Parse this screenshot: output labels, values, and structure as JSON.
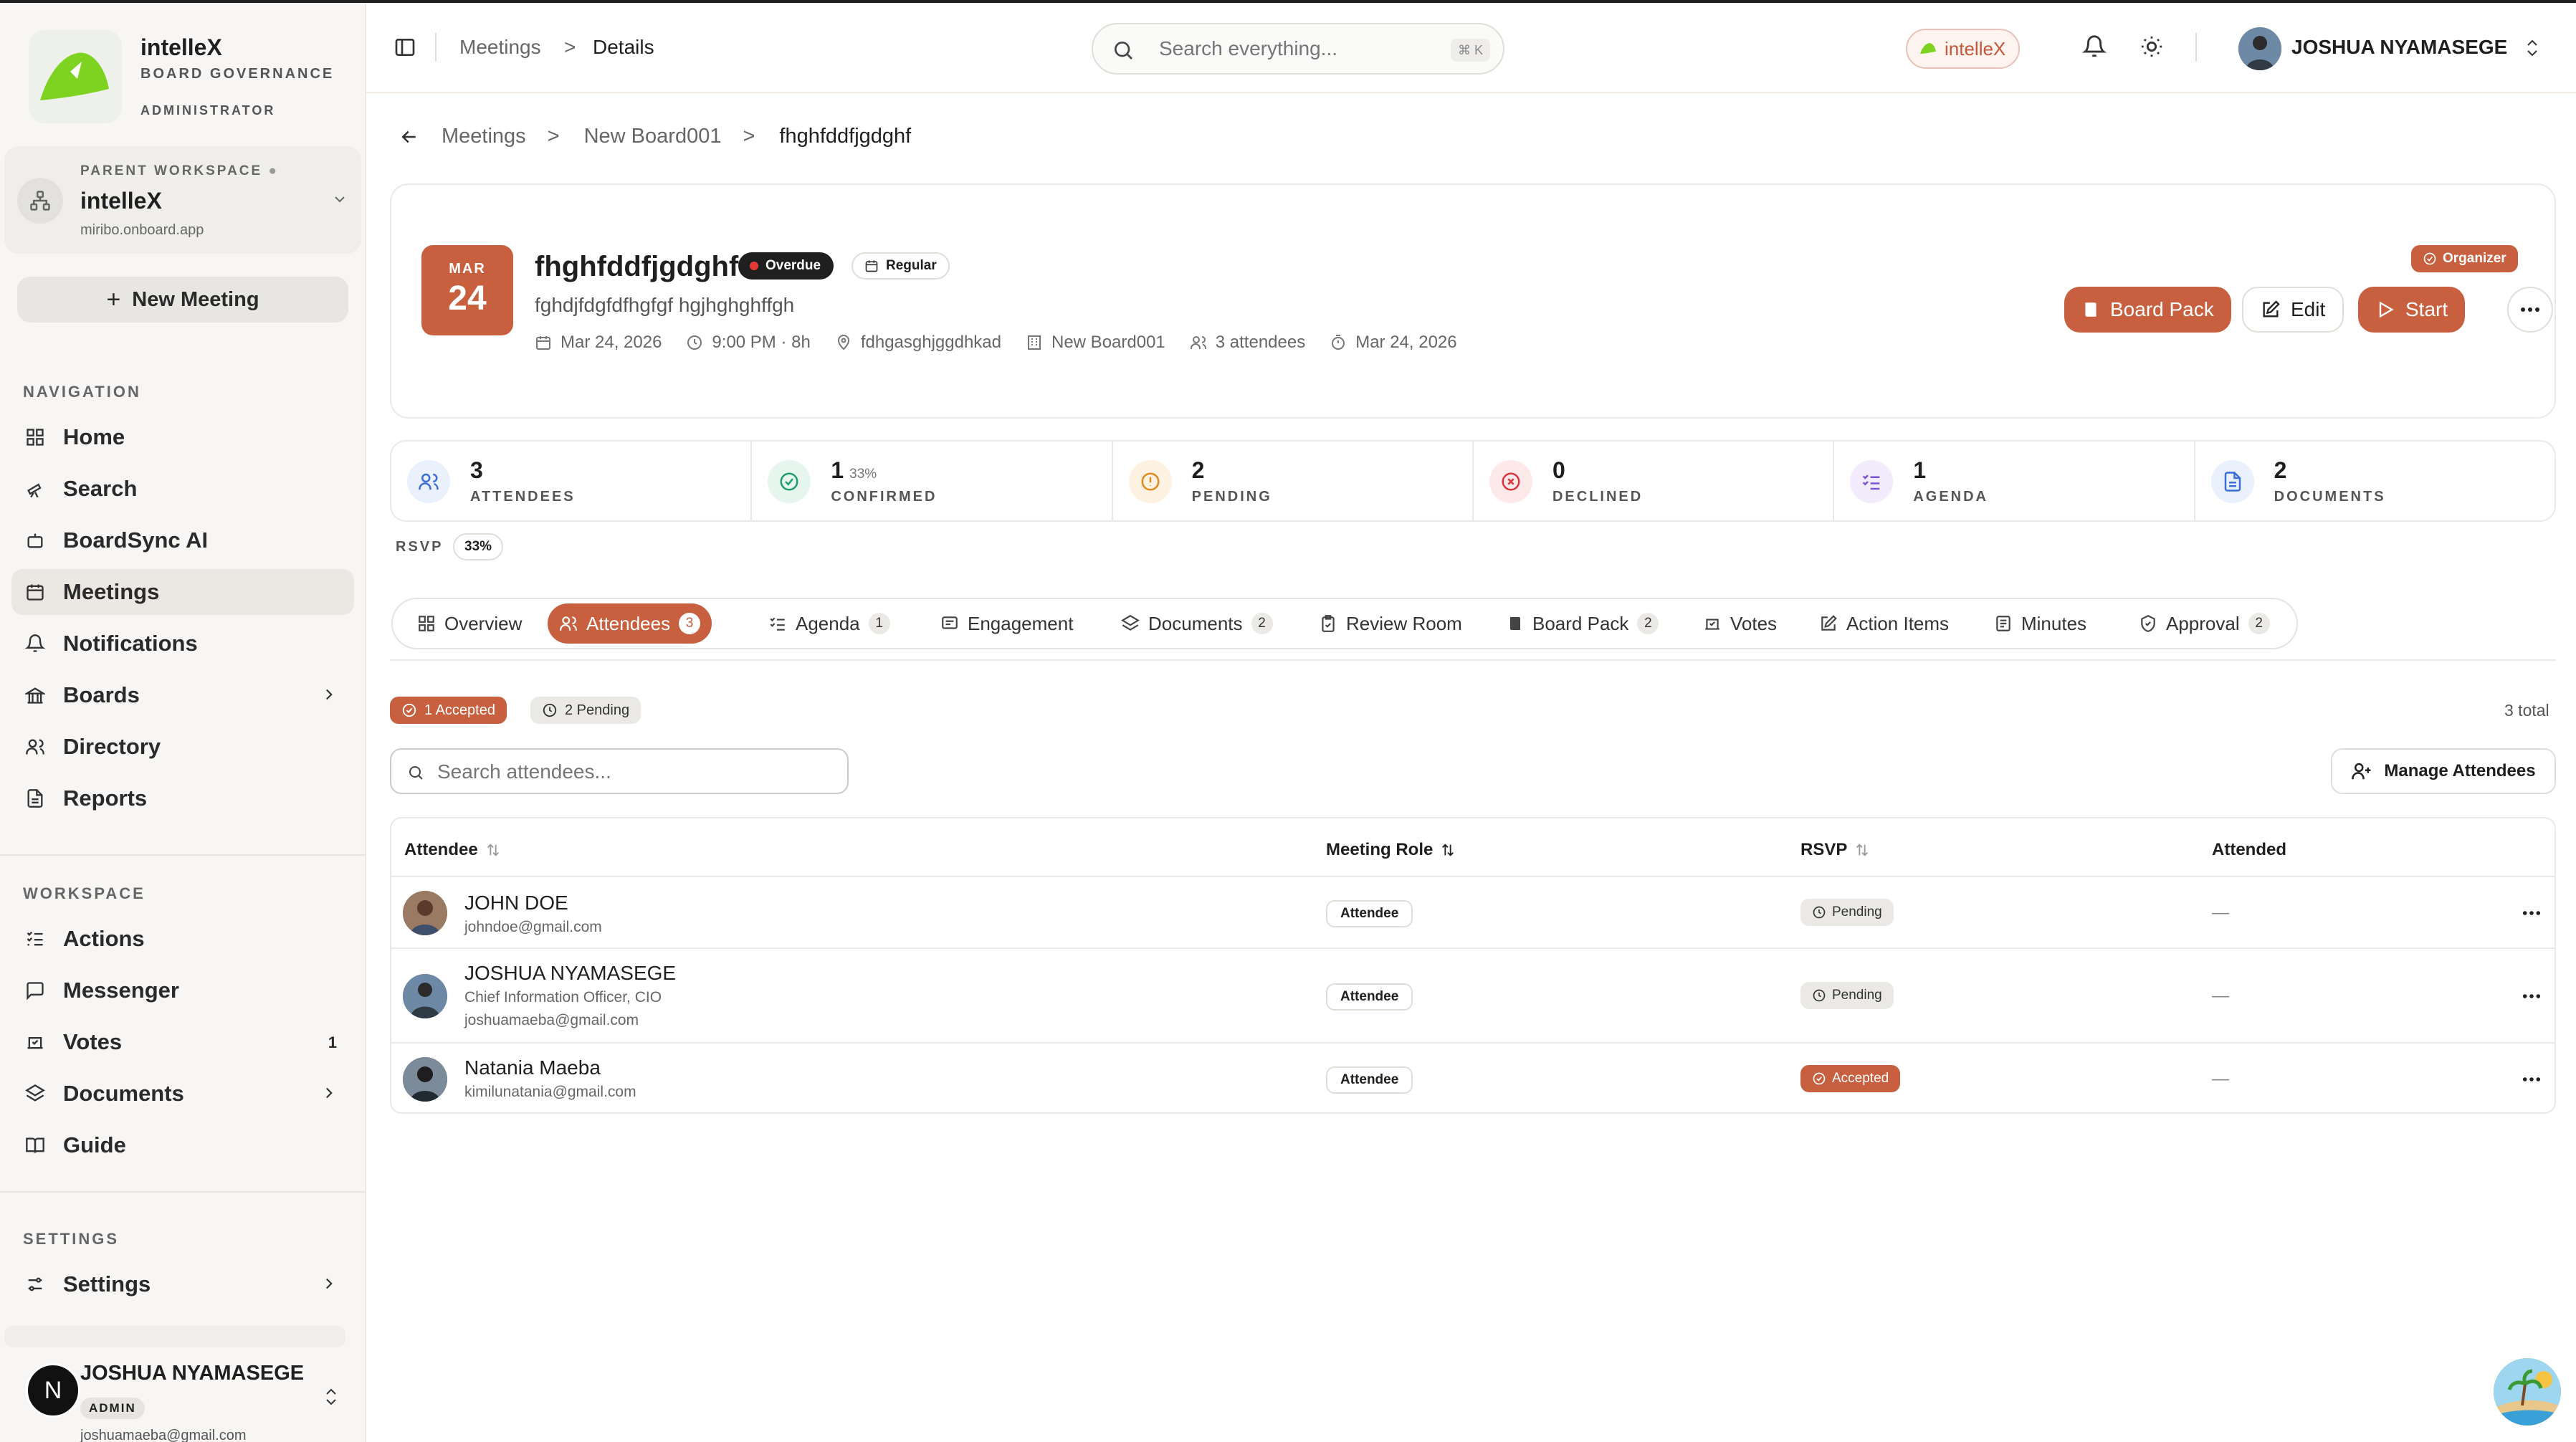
{
  "sidebar": {
    "brand": {
      "name": "intelleX",
      "subtitle": "BOARD GOVERNANCE",
      "role": "ADMINISTRATOR"
    },
    "workspace": {
      "label": "PARENT WORKSPACE",
      "name": "intelleX",
      "url": "miribo.onboard.app"
    },
    "new_meeting": "New Meeting",
    "sections": {
      "navigation": "NAVIGATION",
      "workspace": "WORKSPACE",
      "settings": "SETTINGS"
    },
    "nav": [
      {
        "label": "Home",
        "icon": "grid-icon"
      },
      {
        "label": "Search",
        "icon": "telescope-icon"
      },
      {
        "label": "BoardSync AI",
        "icon": "bot-icon"
      },
      {
        "label": "Meetings",
        "icon": "calendar-icon",
        "active": true
      },
      {
        "label": "Notifications",
        "icon": "bell-icon"
      },
      {
        "label": "Boards",
        "icon": "landmark-icon",
        "chevron": true
      },
      {
        "label": "Directory",
        "icon": "users-icon"
      },
      {
        "label": "Reports",
        "icon": "file-text-icon"
      }
    ],
    "workspace_nav": [
      {
        "label": "Actions",
        "icon": "list-checks-icon"
      },
      {
        "label": "Messenger",
        "icon": "chat-icon"
      },
      {
        "label": "Votes",
        "icon": "vote-icon",
        "count": "1"
      },
      {
        "label": "Documents",
        "icon": "layers-icon",
        "chevron": true
      },
      {
        "label": "Guide",
        "icon": "book-icon"
      }
    ],
    "settings_nav": [
      {
        "label": "Settings",
        "icon": "sliders-icon",
        "chevron": true
      }
    ],
    "user": {
      "initial": "N",
      "name": "JOSHUA NYAMASEGE",
      "role": "ADMIN",
      "email": "joshuamaeba@gmail.com"
    }
  },
  "topbar": {
    "crumbs": [
      "Meetings",
      "Details"
    ],
    "crumb_sep": ">",
    "search_placeholder": "Search everything...",
    "shortcut": "⌘ K",
    "org": "intelleX",
    "user": "JOSHUA NYAMASEGE"
  },
  "breadcrumb": {
    "items": [
      "Meetings",
      "New Board001",
      "fhghfddfjgdghf"
    ],
    "sep": ">"
  },
  "meeting": {
    "month": "MAR",
    "day": "24",
    "title": "fhghfddfjgdghf",
    "status": "Overdue",
    "type": "Regular",
    "description": "fghdjfdgfdfhgfgf hgjhghghffgh",
    "meta": {
      "date": "Mar 24, 2026",
      "time": "9:00 PM · 8h",
      "location": "fdhgasghjggdhkad",
      "board": "New Board001",
      "attendees": "3 attendees",
      "deadline": "Mar 24, 2026"
    },
    "organizer": "Organizer",
    "actions": {
      "board_pack": "Board Pack",
      "edit": "Edit",
      "start": "Start"
    }
  },
  "stats": [
    {
      "value": "3",
      "label": "ATTENDEES",
      "icon": "users-icon",
      "color": "#3b6fd8",
      "bg": "#eaf0fc"
    },
    {
      "value": "1",
      "pct": "33%",
      "label": "CONFIRMED",
      "icon": "check-circle-icon",
      "color": "#1f9d6b",
      "bg": "#e6f6ef"
    },
    {
      "value": "2",
      "label": "PENDING",
      "icon": "clock-alert-icon",
      "color": "#e08a1e",
      "bg": "#fdf1e2"
    },
    {
      "value": "0",
      "label": "DECLINED",
      "icon": "x-circle-icon",
      "color": "#d9363e",
      "bg": "#fde9ea"
    },
    {
      "value": "1",
      "label": "AGENDA",
      "icon": "list-icon",
      "color": "#7a52d6",
      "bg": "#f1ebfc"
    },
    {
      "value": "2",
      "label": "DOCUMENTS",
      "icon": "document-icon",
      "color": "#3b6fd8",
      "bg": "#eaf0fc"
    }
  ],
  "rsvp": {
    "label": "RSVP",
    "value": "33%"
  },
  "tabs": [
    {
      "label": "Overview",
      "icon": "grid-icon"
    },
    {
      "label": "Attendees",
      "icon": "users-icon",
      "count": "3",
      "active": true
    },
    {
      "label": "Agenda",
      "icon": "list-icon",
      "count": "1"
    },
    {
      "label": "Engagement",
      "icon": "message-square-icon"
    },
    {
      "label": "Documents",
      "icon": "layers-icon",
      "count": "2"
    },
    {
      "label": "Review Room",
      "icon": "clipboard-check-icon"
    },
    {
      "label": "Board Pack",
      "icon": "book-icon",
      "count": "2"
    },
    {
      "label": "Votes",
      "icon": "vote-icon"
    },
    {
      "label": "Action Items",
      "icon": "edit-square-icon"
    },
    {
      "label": "Minutes",
      "icon": "notes-icon"
    },
    {
      "label": "Approval",
      "icon": "shield-check-icon",
      "count": "2"
    }
  ],
  "filters": {
    "accepted": "1 Accepted",
    "pending": "2 Pending",
    "total": "3 total"
  },
  "attendee_search_placeholder": "Search attendees...",
  "manage_attendees": "Manage Attendees",
  "table": {
    "headers": {
      "attendee": "Attendee",
      "role": "Meeting Role",
      "rsvp": "RSVP",
      "attended": "Attended"
    },
    "rows": [
      {
        "name": "JOHN DOE",
        "title": "",
        "email": "johndoe@gmail.com",
        "role": "Attendee",
        "rsvp": "Pending",
        "attended": "—",
        "avatar_color": "#8a6a55"
      },
      {
        "name": "JOSHUA NYAMASEGE",
        "title": "Chief Information Officer, CIO",
        "email": "joshuamaeba@gmail.com",
        "role": "Attendee",
        "rsvp": "Pending",
        "attended": "—",
        "avatar_color": "#5f7a96"
      },
      {
        "name": "Natania Maeba",
        "title": "",
        "email": "kimilunatania@gmail.com",
        "role": "Attendee",
        "rsvp": "Accepted",
        "attended": "—",
        "avatar_color": "#3a3a3a"
      }
    ]
  },
  "colors": {
    "accent": "#c8603f",
    "brand_green": "#7ed321"
  }
}
